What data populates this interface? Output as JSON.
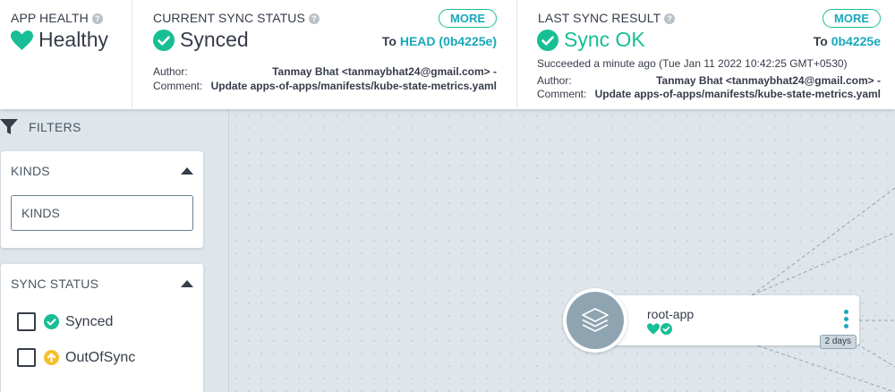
{
  "app_health": {
    "title": "APP HEALTH",
    "status": "Healthy",
    "status_icon": "heart-icon",
    "color": "#18be94"
  },
  "current_sync": {
    "title": "CURRENT SYNC STATUS",
    "status": "Synced",
    "status_icon": "check-circle-icon",
    "more_label": "MORE",
    "to_prefix": "To",
    "revision": "HEAD (0b4225e)",
    "author_label": "Author:",
    "author_value": "Tanmay Bhat <tanmaybhat24@gmail.com> -",
    "comment_label": "Comment:",
    "comment_value": "Update apps-of-apps/manifests/kube-state-metrics.yaml"
  },
  "last_sync": {
    "title": "LAST SYNC RESULT",
    "status": "Sync OK",
    "status_icon": "check-circle-icon",
    "more_label": "MORE",
    "to_prefix": "To",
    "revision": "0b4225e",
    "succeeded_text": "Succeeded a minute ago (Tue Jan 11 2022 10:42:25 GMT+0530)",
    "author_label": "Author:",
    "author_value": "Tanmay Bhat <tanmaybhat24@gmail.com> -",
    "comment_label": "Comment:",
    "comment_value": "Update apps-of-apps/manifests/kube-state-metrics.yaml"
  },
  "filters": {
    "header": "FILTERS",
    "kinds": {
      "title": "KINDS",
      "input_value": "",
      "input_placeholder": "KINDS"
    },
    "sync_status": {
      "title": "SYNC STATUS",
      "options": [
        {
          "label": "Synced",
          "icon": "check-circle-icon",
          "checked": false
        },
        {
          "label": "OutOfSync",
          "icon": "arrow-up-circle-icon",
          "checked": false
        }
      ]
    }
  },
  "graph": {
    "node": {
      "name": "root-app",
      "icon": "layers-icon",
      "health_icon": "heart-icon",
      "sync_icon": "check-circle-icon",
      "age": "2 days"
    }
  },
  "colors": {
    "accent": "#18a8ba",
    "ok": "#18be94",
    "warning": "#f4c030",
    "canvas": "#dee6eb"
  }
}
